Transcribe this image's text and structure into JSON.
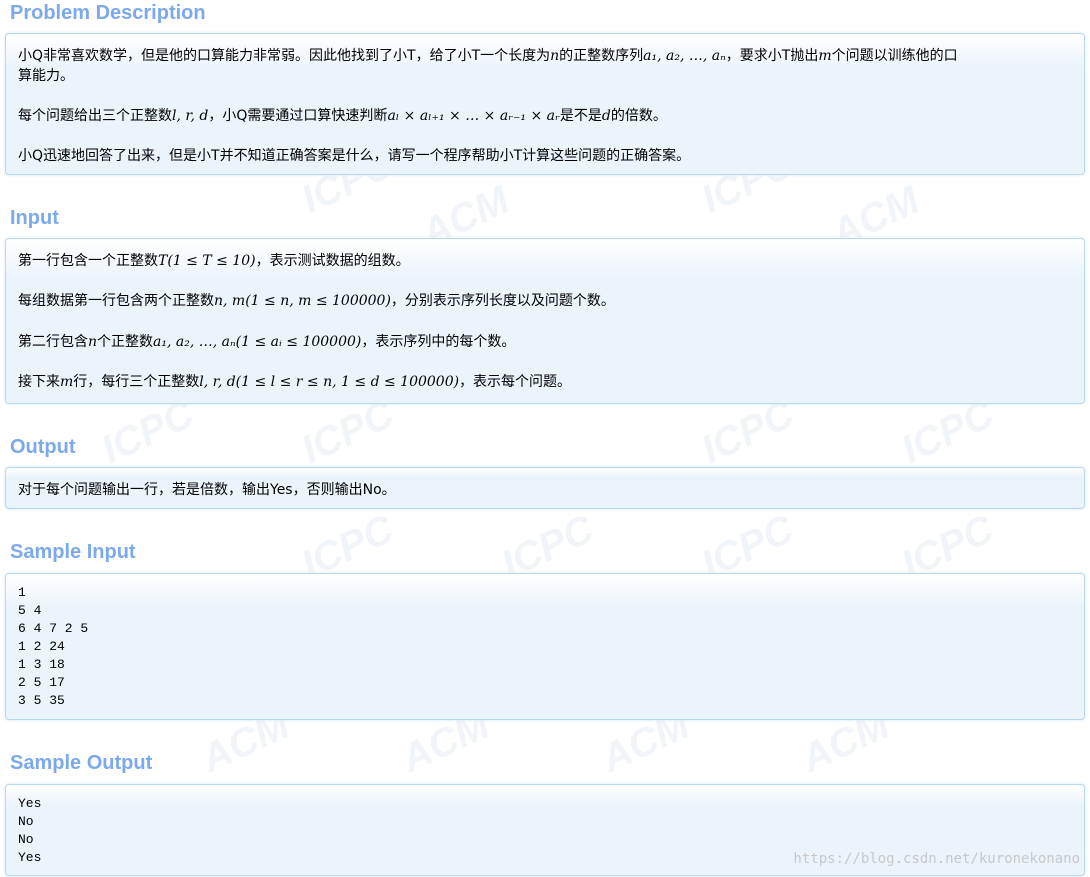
{
  "watermark": {
    "tokens": [
      "ICPC",
      "ACM"
    ]
  },
  "problem_description": {
    "title": "Problem Description",
    "p1_a": "小Q非常喜欢数学，但是他的口算能力非常弱。因此他找到了小T，给了小T一个长度为",
    "p1_n": "n",
    "p1_b": "的正整数序列",
    "p1_seq": "a₁, a₂, …, aₙ",
    "p1_c": "，要求小T抛出",
    "p1_m": "m",
    "p1_d": "个问题以训练他的口",
    "p1_line2": "算能力。",
    "p2_a": "每个问题给出三个正整数",
    "p2_lrd": "l, r, d",
    "p2_b": "，小Q需要通过口算快速判断",
    "p2_prod": "aₗ × aₗ₊₁ × … × aᵣ₋₁ × aᵣ",
    "p2_c": "是不是",
    "p2_d": "d",
    "p2_e": "的倍数。",
    "p3": "小Q迅速地回答了出来，但是小T并不知道正确答案是什么，请写一个程序帮助小T计算这些问题的正确答案。"
  },
  "input": {
    "title": "Input",
    "l1_a": "第一行包含一个正整数",
    "l1_m": "T(1 ≤ T ≤ 10)",
    "l1_b": "，表示测试数据的组数。",
    "l2_a": "每组数据第一行包含两个正整数",
    "l2_m": "n, m(1 ≤ n, m ≤ 100000)",
    "l2_b": "，分别表示序列长度以及问题个数。",
    "l3_a": "第二行包含",
    "l3_n": "n",
    "l3_b": "个正整数",
    "l3_m": "a₁, a₂, …, aₙ(1 ≤ aᵢ ≤ 100000)",
    "l3_c": "，表示序列中的每个数。",
    "l4_a": "接下来",
    "l4_m1": "m",
    "l4_b": "行，每行三个正整数",
    "l4_m2": "l, r, d(1 ≤ l ≤ r ≤ n, 1 ≤ d ≤ 100000)",
    "l4_c": "，表示每个问题。"
  },
  "output": {
    "title": "Output",
    "text": "对于每个问题输出一行，若是倍数，输出Yes，否则输出No。"
  },
  "sample_input": {
    "title": "Sample Input",
    "text": "1\n5 4\n6 4 7 2 5\n1 2 24\n1 3 18\n2 5 17\n3 5 35"
  },
  "sample_output": {
    "title": "Sample Output",
    "text": "Yes\nNo\nNo\nYes"
  },
  "footer": {
    "url": "https://blog.csdn.net/kuronekonano"
  }
}
